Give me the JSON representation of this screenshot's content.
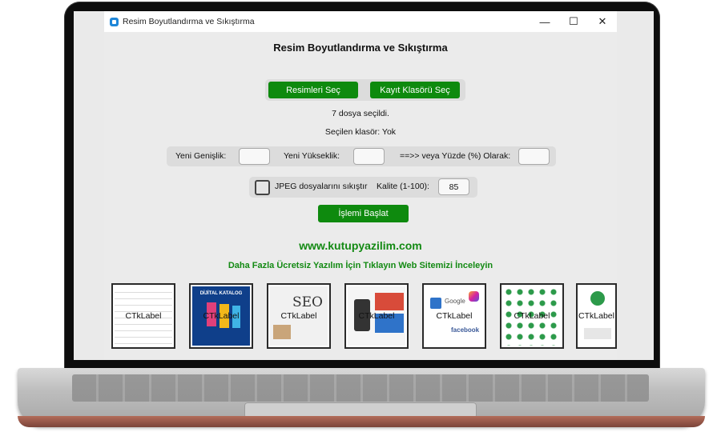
{
  "window": {
    "title": "Resim Boyutlandırma ve Sıkıştırma",
    "controls": {
      "minimize": "—",
      "maximize": "☐",
      "close": "✕"
    }
  },
  "main": {
    "heading": "Resim Boyutlandırma ve Sıkıştırma",
    "select_images_label": "Resimleri Seç",
    "select_folder_label": "Kayıt Klasörü Seç",
    "files_selected": "7 dosya seçildi.",
    "selected_folder": "Seçilen klasör: Yok",
    "width_label": "Yeni Genişlik:",
    "width_value": "",
    "height_label": "Yeni Yükseklik:",
    "height_value": "",
    "percent_label": "==>> veya  Yüzde (%) Olarak:",
    "percent_value": "",
    "compress_label": "JPEG dosyalarını sıkıştır",
    "compress_checked": false,
    "quality_label": "Kalite (1-100):",
    "quality_value": "85",
    "start_label": "İşlemi Başlat"
  },
  "promo": {
    "website": "www.kutupyazilim.com",
    "tagline": "Daha Fazla Ücretsiz Yazılım İçin Tıklayın Web Sitemizi İnceleyin",
    "thumbnails": [
      {
        "caption": "CTkLabel"
      },
      {
        "caption": "CTkLabel",
        "art_text": "DİJİTAL KATALOG"
      },
      {
        "caption": "CTkLabel",
        "art_text": "SEO"
      },
      {
        "caption": "CTkLabel"
      },
      {
        "caption": "CTkLabel",
        "art_text": "Google",
        "art_text2": "facebook"
      },
      {
        "caption": "CTkLabel"
      },
      {
        "caption": "CTkLabel"
      }
    ]
  },
  "colors": {
    "accent_green": "#0e8a0e",
    "link_green": "#138a13",
    "background": "#ebebeb"
  }
}
